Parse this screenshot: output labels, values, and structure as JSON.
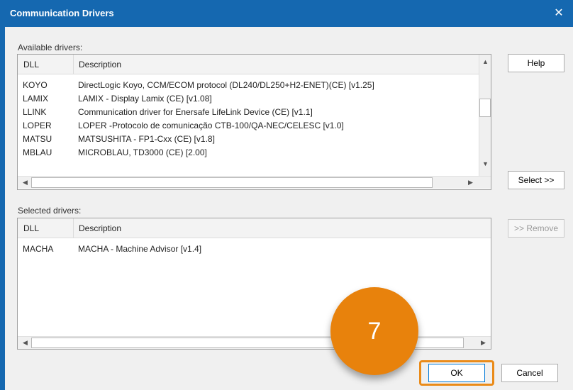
{
  "window": {
    "title": "Communication Drivers",
    "close_glyph": "✕"
  },
  "available": {
    "label": "Available drivers:",
    "columns": [
      "DLL",
      "Description"
    ],
    "rows": [
      {
        "dll": "KOYO",
        "desc": "DirectLogic Koyo, CCM/ECOM protocol (DL240/DL250+H2-ENET)(CE) [v1.25]"
      },
      {
        "dll": "LAMIX",
        "desc": "LAMIX - Display Lamix (CE) [v1.08]"
      },
      {
        "dll": "LLINK",
        "desc": "Communication driver for Enersafe LifeLink Device (CE) [v1.1]"
      },
      {
        "dll": "LOPER",
        "desc": "LOPER -Protocolo de comunicação CTB-100/QA-NEC/CELESC [v1.0]"
      },
      {
        "dll": "MATSU",
        "desc": "MATSUSHITA - FP1-Cxx (CE) [v1.8]"
      },
      {
        "dll": "MBLAU",
        "desc": "MICROBLAU, TD3000 (CE) [2.00]"
      }
    ]
  },
  "selected": {
    "label": "Selected drivers:",
    "columns": [
      "DLL",
      "Description"
    ],
    "rows": [
      {
        "dll": "MACHA",
        "desc": "MACHA - Machine Advisor [v1.4]"
      }
    ]
  },
  "buttons": {
    "help": "Help",
    "select": "Select >>",
    "remove": ">> Remove",
    "ok": "OK",
    "cancel": "Cancel"
  },
  "annotation": {
    "step": "7",
    "color": "#e8820c"
  },
  "icons": {
    "up": "▲",
    "down": "▼",
    "left": "◀",
    "right": "▶"
  }
}
